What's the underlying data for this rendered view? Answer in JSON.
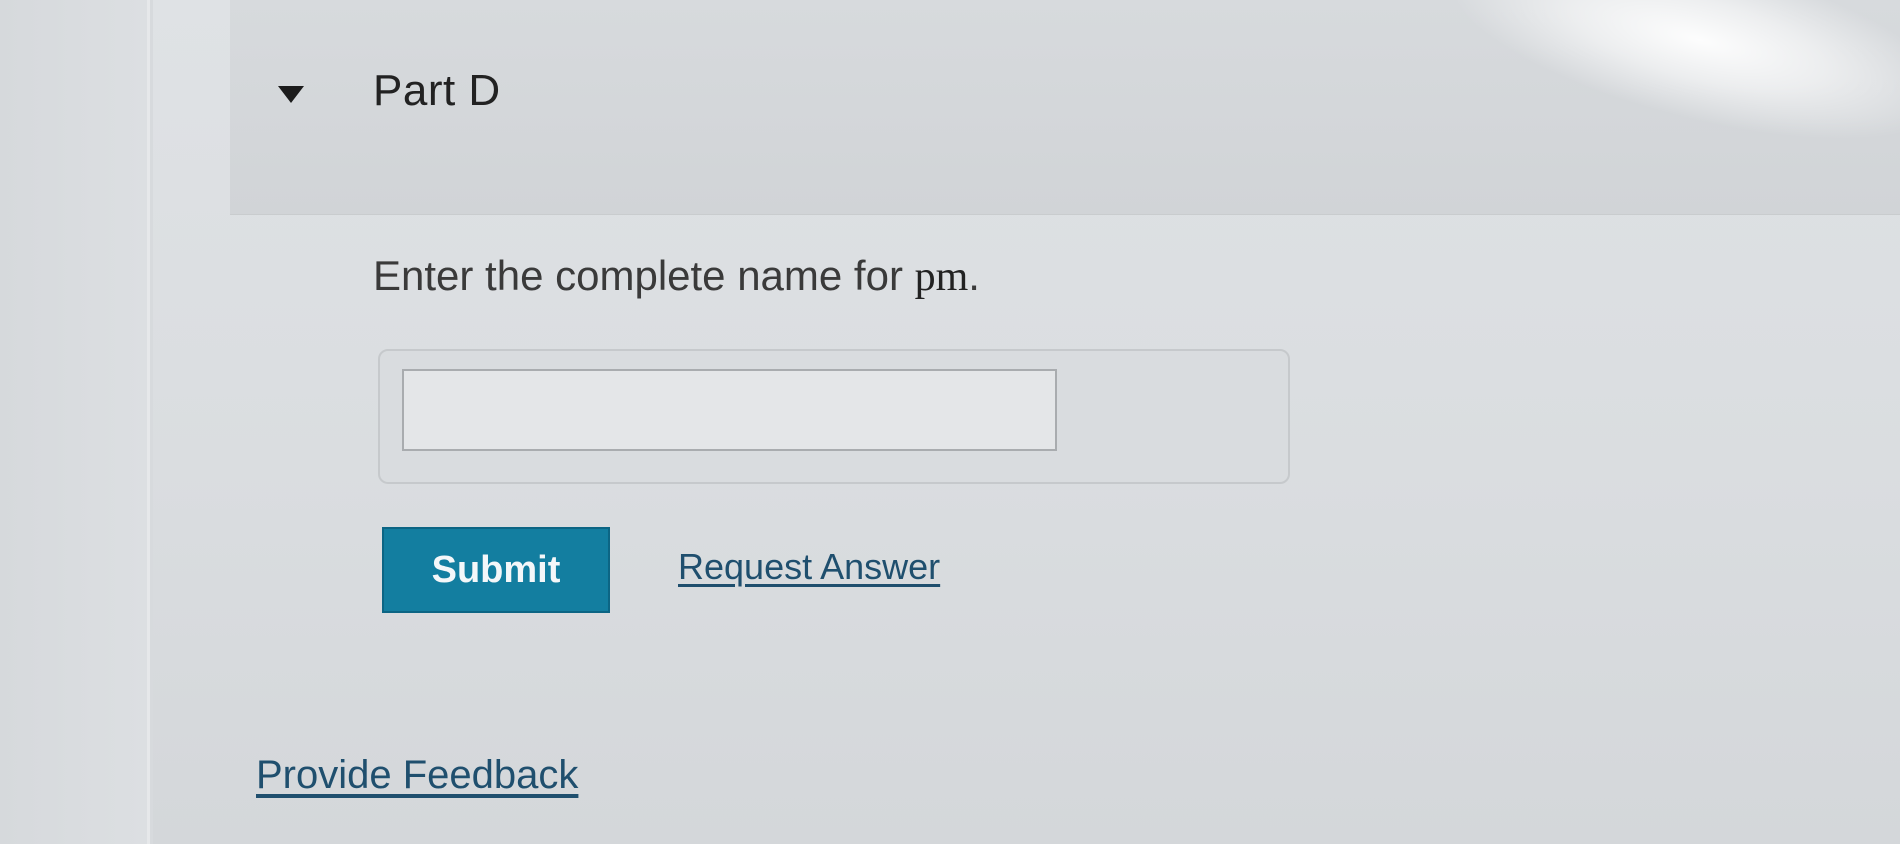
{
  "part": {
    "title": "Part D",
    "toggle_icon": "caret-down-icon"
  },
  "question": {
    "prompt_prefix": "Enter the complete name for ",
    "math_term": "pm",
    "prompt_suffix": "."
  },
  "answer": {
    "value": "",
    "placeholder": ""
  },
  "actions": {
    "submit_label": "Submit",
    "request_answer_label": "Request Answer"
  },
  "footer": {
    "feedback_label": "Provide Feedback"
  },
  "colors": {
    "submit_bg": "#137ea0",
    "link": "#1f4f6e"
  }
}
